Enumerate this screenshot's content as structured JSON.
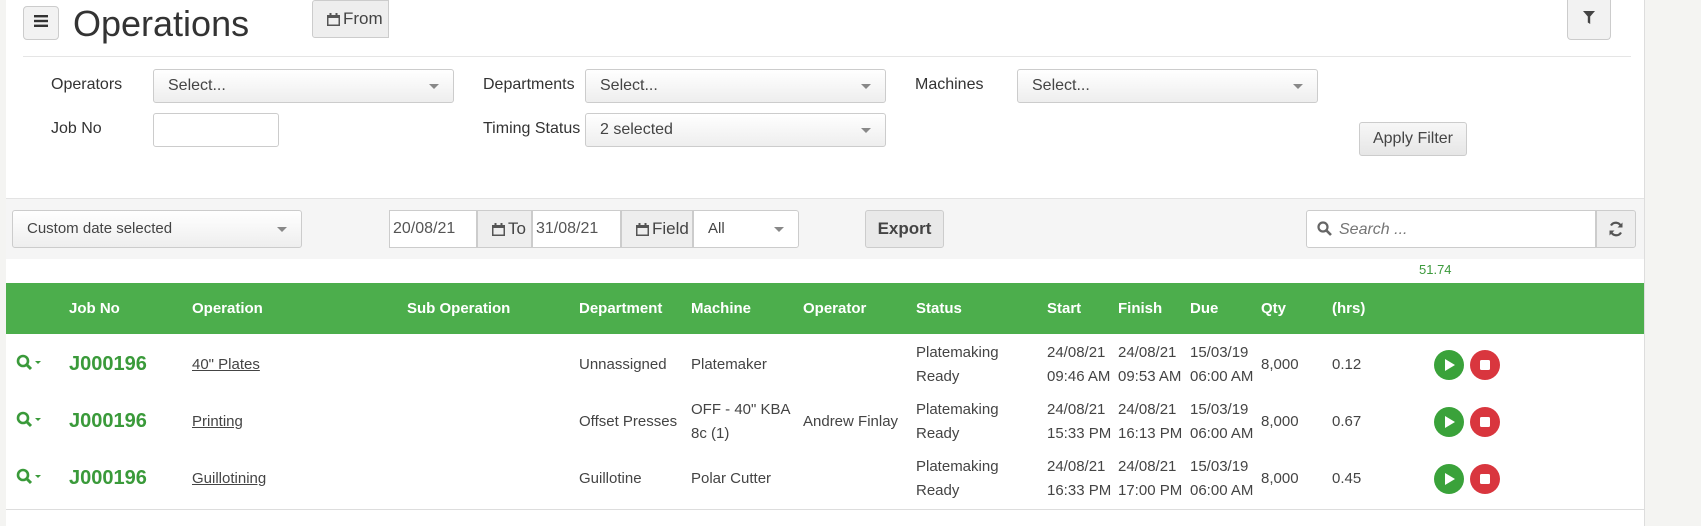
{
  "header": {
    "title": "Operations"
  },
  "filters": {
    "operators_label": "Operators",
    "operators_value": "Select...",
    "departments_label": "Departments",
    "departments_value": "Select...",
    "machines_label": "Machines",
    "machines_value": "Select...",
    "jobno_label": "Job No",
    "jobno_value": "",
    "timing_label": "Timing Status",
    "timing_value": "2 selected",
    "apply_label": "Apply Filter"
  },
  "toolbar": {
    "date_range": "Custom date selected",
    "from_label": "From",
    "from_value": "20/08/21",
    "to_label": "To",
    "to_value": "31/08/21",
    "field_label": "Field",
    "field_value": "All",
    "export_label": "Export",
    "search_placeholder": "Search ..."
  },
  "totals": {
    "hours": "51.74"
  },
  "table": {
    "columns": {
      "job_no": "Job No",
      "operation": "Operation",
      "sub_operation": "Sub Operation",
      "department": "Department",
      "machine": "Machine",
      "operator": "Operator",
      "status": "Status",
      "start": "Start",
      "finish": "Finish",
      "due": "Due",
      "qty": "Qty",
      "hrs": "(hrs)"
    },
    "rows": [
      {
        "job_no": "J000196",
        "operation": "40\" Plates",
        "sub_operation": "",
        "department": "Unnassigned",
        "machine_line1": "Platemaker",
        "machine_line2": "",
        "operator": "",
        "status_line1": "Platemaking",
        "status_line2": "Ready",
        "start_date": "24/08/21",
        "start_time": "09:46 AM",
        "finish_date": "24/08/21",
        "finish_time": "09:53 AM",
        "due_date": "15/03/19",
        "due_time": "06:00 AM",
        "qty": "8,000",
        "hrs": "0.12"
      },
      {
        "job_no": "J000196",
        "operation": "Printing",
        "sub_operation": "",
        "department": "Offset Presses",
        "machine_line1": "OFF - 40\" KBA",
        "machine_line2": "8c (1)",
        "operator": "Andrew Finlay",
        "status_line1": "Platemaking",
        "status_line2": "Ready",
        "start_date": "24/08/21",
        "start_time": "15:33 PM",
        "finish_date": "24/08/21",
        "finish_time": "16:13 PM",
        "due_date": "15/03/19",
        "due_time": "06:00 AM",
        "qty": "8,000",
        "hrs": "0.67"
      },
      {
        "job_no": "J000196",
        "operation": "Guillotining",
        "sub_operation": "",
        "department": "Guillotine",
        "machine_line1": "Polar Cutter",
        "machine_line2": "",
        "operator": "",
        "status_line1": "Platemaking",
        "status_line2": "Ready",
        "start_date": "24/08/21",
        "start_time": "16:33 PM",
        "finish_date": "24/08/21",
        "finish_time": "17:00 PM",
        "due_date": "15/03/19",
        "due_time": "06:00 AM",
        "qty": "8,000",
        "hrs": "0.45"
      }
    ]
  },
  "colors": {
    "accent": "#4cae4c",
    "play": "#3aa23a",
    "stop": "#d9363e"
  },
  "icons": [
    "menu-icon",
    "filter-icon",
    "calendar-icon",
    "search-icon",
    "refresh-icon",
    "zoom-dropdown-icon",
    "play-icon",
    "stop-icon"
  ]
}
